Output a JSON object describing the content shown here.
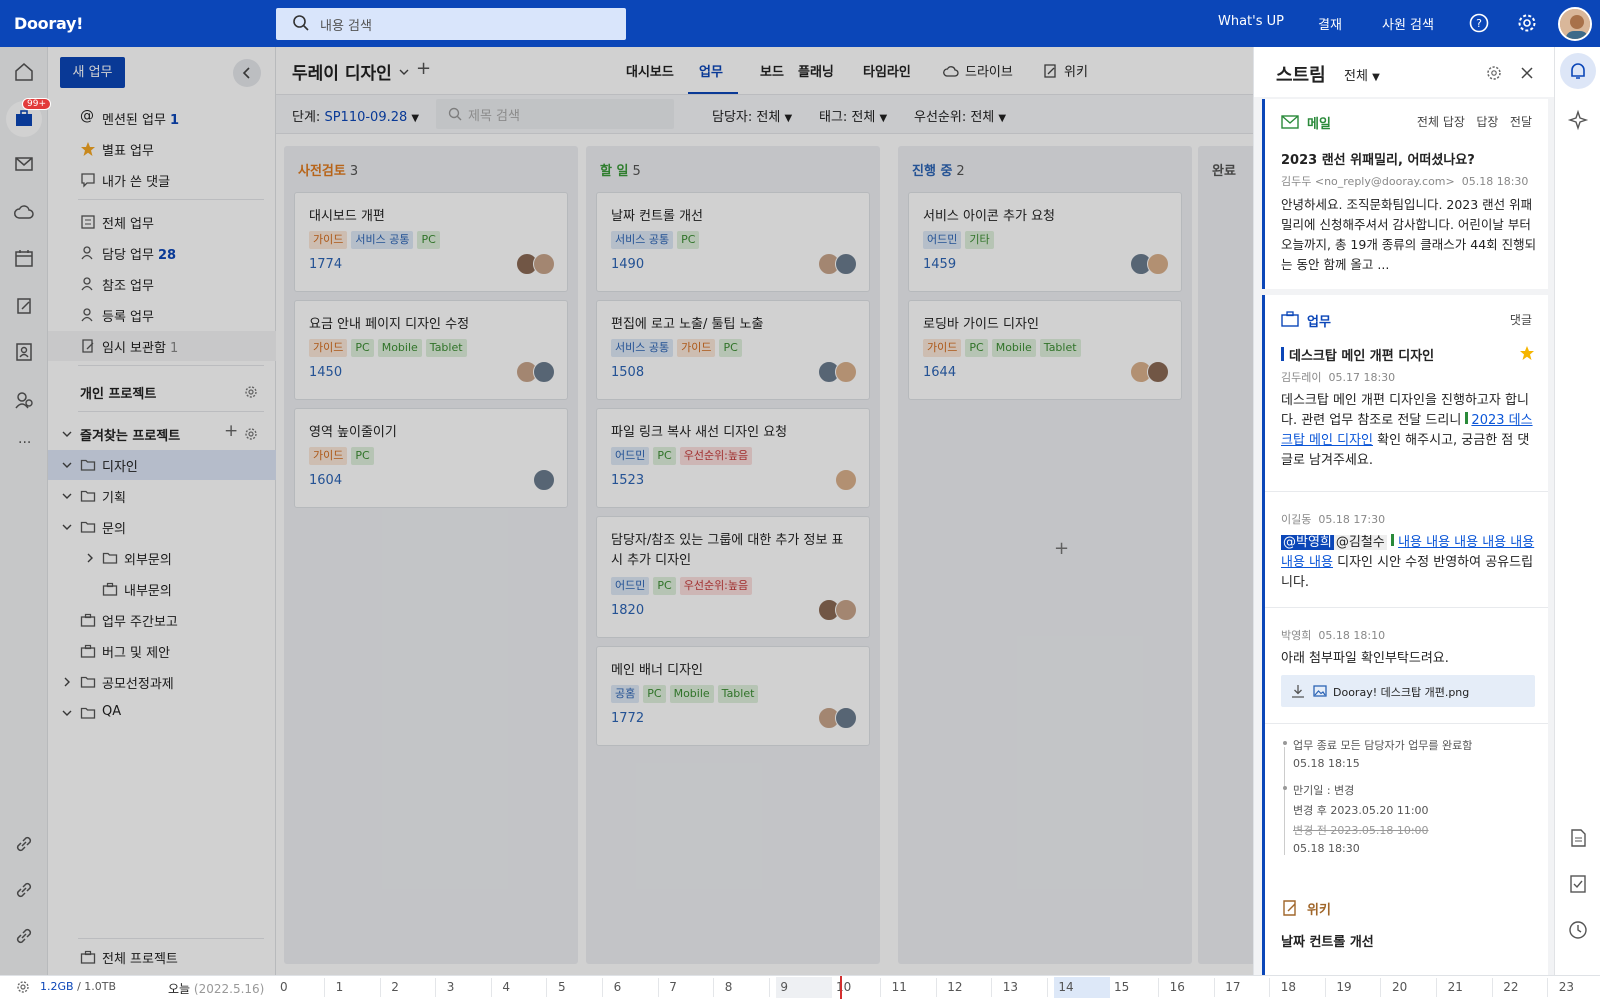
{
  "app": {
    "logo": "Dooray!",
    "search_placeholder": "내용 검색"
  },
  "topnav": {
    "whatsup": "What's UP",
    "approval": "결재",
    "people": "사원 검색"
  },
  "rail_badge": "99+",
  "sidebar": {
    "new_task": "새 업무",
    "items": [
      {
        "label": "멘션된 업무",
        "count": "1"
      },
      {
        "label": "별표 업무"
      },
      {
        "label": "내가 쓴 댓글"
      },
      {
        "label": "전체 업무"
      },
      {
        "label": "담당 업무",
        "count": "28"
      },
      {
        "label": "참조 업무"
      },
      {
        "label": "등록 업무"
      },
      {
        "label": "임시 보관함",
        "count": "1"
      }
    ],
    "personal": "개인 프로젝트",
    "favorites": "즐겨찾는 프로젝트",
    "projects": [
      {
        "label": "디자인"
      },
      {
        "label": "기획"
      },
      {
        "label": "문의"
      },
      {
        "label": "외부문의"
      },
      {
        "label": "내부문의"
      },
      {
        "label": "업무 주간보고"
      },
      {
        "label": "버그 및 제안"
      },
      {
        "label": "공모선정과제"
      },
      {
        "label": "QA"
      }
    ],
    "all_projects": "전체 프로젝트"
  },
  "main": {
    "title": "두레이 디자인",
    "tabs": [
      "대시보드",
      "업무",
      "보드",
      "플래닝",
      "타임라인",
      "드라이브",
      "위키"
    ],
    "filters": {
      "stage_label": "단계:",
      "stage_value": "SP110-09.28",
      "search_placeholder": "제목 검색",
      "assignee": "담당자: 전체",
      "tag": "태그: 전체",
      "priority": "우선순위: 전체"
    },
    "columns": [
      {
        "name": "사전검토",
        "count": "3",
        "color": "#e07b1f",
        "cards": [
          {
            "title": "대시보드 개편",
            "tags": [
              [
                "가이드",
                "o"
              ],
              [
                "서비스 공통",
                "b"
              ],
              [
                "PC",
                "g"
              ]
            ],
            "num": "1774"
          },
          {
            "title": "요금 안내 페이지 디자인 수정",
            "tags": [
              [
                "가이드",
                "o"
              ],
              [
                "PC",
                "g"
              ],
              [
                "Mobile",
                "g"
              ],
              [
                "Tablet",
                "g"
              ]
            ],
            "num": "1450"
          },
          {
            "title": "영역 높이줄이기",
            "tags": [
              [
                "가이드",
                "o"
              ],
              [
                "PC",
                "g"
              ]
            ],
            "num": "1604"
          }
        ]
      },
      {
        "name": "할 일",
        "count": "5",
        "color": "#3b9a3a",
        "cards": [
          {
            "title": "날짜 컨트롤 개선",
            "tags": [
              [
                "서비스 공통",
                "b"
              ],
              [
                "PC",
                "g"
              ]
            ],
            "num": "1490"
          },
          {
            "title": "편집에 로고 노출/ 툴팁 노출",
            "tags": [
              [
                "서비스 공통",
                "b"
              ],
              [
                "가이드",
                "o"
              ],
              [
                "PC",
                "g"
              ]
            ],
            "num": "1508"
          },
          {
            "title": "파일 링크 복사 새선 디자인 요청",
            "tags": [
              [
                "어드민",
                "b"
              ],
              [
                "PC",
                "g"
              ],
              [
                "우선순위:높음",
                "r"
              ]
            ],
            "num": "1523"
          },
          {
            "title": "담당자/참조 있는 그룹에 대한 추가 정보 표시 추가 디자인",
            "tags": [
              [
                "어드민",
                "b"
              ],
              [
                "PC",
                "g"
              ],
              [
                "우선순위:높음",
                "r"
              ]
            ],
            "num": "1820"
          },
          {
            "title": "메인 배너 디자인",
            "tags": [
              [
                "공홈",
                "b"
              ],
              [
                "PC",
                "g"
              ],
              [
                "Mobile",
                "g"
              ],
              [
                "Tablet",
                "g"
              ]
            ],
            "num": "1772"
          }
        ]
      },
      {
        "name": "진행 중",
        "count": "2",
        "color": "#2c64b5",
        "cards": [
          {
            "title": "서비스 아이콘 추가 요청",
            "tags": [
              [
                "어드민",
                "b"
              ],
              [
                "기타",
                "g"
              ]
            ],
            "num": "1459"
          },
          {
            "title": "로딩바 가이드 디자인",
            "tags": [
              [
                "가이드",
                "o"
              ],
              [
                "PC",
                "g"
              ],
              [
                "Mobile",
                "g"
              ],
              [
                "Tablet",
                "g"
              ]
            ],
            "num": "1644"
          }
        ]
      },
      {
        "name": "완료",
        "count": "",
        "color": "#555555",
        "cards": []
      }
    ]
  },
  "stream": {
    "title": "스트림",
    "filter": "전체",
    "mail": {
      "type": "메일",
      "actions": [
        "전체 답장",
        "답장",
        "전달"
      ],
      "subject": "2023 랜선 위패밀리, 어떠셨나요?",
      "from": "김두두 <no_reply@dooray.com>",
      "date": "05.18 18:30",
      "body": "안녕하세요. 조직문화팀입니다. 2023 랜선 위패밀리에 신청해주셔서 감사합니다. 어린이날 부터 오늘까지, 총 19개 종류의 클래스가 44회 진행되는 동안 함께 올고 ..."
    },
    "task": {
      "type": "업무",
      "action": "댓글",
      "title": "데스크탑 메인 개편 디자인",
      "author": "김두레이",
      "date": "05.17 18:30",
      "body_1": "데스크탑 메인 개편 디자인을 진행하고자 합니다. 관련 업무 참조로 전달 드리니 ",
      "body_link": "2023 데스크탑 메인 디자인",
      "body_2": " 확인 해주시고, 궁금한 점 댓글로 남겨주세요.",
      "c1_author": "이길동",
      "c1_date": "05.18 17:30",
      "c1_mention1": "@박영희",
      "c1_mention2": "@김철수",
      "c1_link": "내용 내용 내용 내용 내용 내용 내용",
      "c1_text": " 디자인 시안 수정 반영하여 공유드립니다.",
      "c2_author": "박영희",
      "c2_date": "05.18 18:10",
      "c2_text": "아래 첨부파일 확인부탁드려요.",
      "c2_file": "Dooray! 데스크탑 개편.png",
      "log1": "업무 종료  모든 담당자가 업무를 완료함",
      "log1_date": "05.18 18:15",
      "log2": "만기일 : 변경",
      "log2_after": "변경 후 2023.05.20 11:00",
      "log2_before": "변경 전 2023.05.18 10:00",
      "log2_date": "05.18 18:30"
    },
    "wiki": {
      "type": "위키",
      "title": "날짜 컨트롤 개선"
    }
  },
  "bottom": {
    "storage_used": "1.2GB",
    "storage_total": " / 1.0TB",
    "today": "오늘",
    "today_date": "(2022.5.16)",
    "hours": [
      "0",
      "1",
      "2",
      "3",
      "4",
      "5",
      "6",
      "7",
      "8",
      "9",
      "10",
      "11",
      "12",
      "13",
      "14",
      "15",
      "16",
      "17",
      "18",
      "19",
      "20",
      "21",
      "22",
      "23"
    ]
  }
}
